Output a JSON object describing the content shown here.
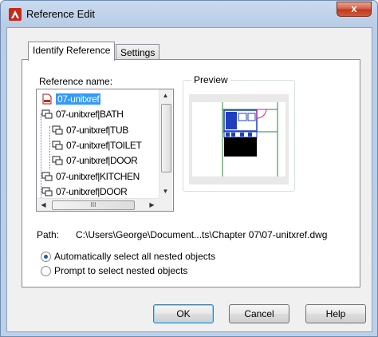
{
  "window": {
    "title": "Reference Edit",
    "close_glyph": "x",
    "app_icon": "autocad-logo-icon",
    "accent": "#c0391e"
  },
  "tabs": [
    {
      "label": "Identify Reference",
      "active": true
    },
    {
      "label": "Settings",
      "active": false
    }
  ],
  "reference": {
    "label": "Reference name:",
    "items": [
      {
        "text": "07-unitxref",
        "icon": "drawing-file-icon",
        "selected": true
      },
      {
        "text": "07-unitxref|BATH",
        "icon": "block-icon"
      },
      {
        "text": "07-unitxref|TUB",
        "icon": "block-icon"
      },
      {
        "text": "07-unitxref|TOILET",
        "icon": "block-icon"
      },
      {
        "text": "07-unitxref|DOOR",
        "icon": "block-icon"
      },
      {
        "text": "07-unitxref|KITCHEN",
        "icon": "block-icon"
      },
      {
        "text": "07-unitxref|DOOR",
        "icon": "block-icon"
      }
    ],
    "scroll_glyph": "III"
  },
  "preview": {
    "label": "Preview"
  },
  "path": {
    "label": "Path:",
    "value": "C:\\Users\\George\\Document...ts\\Chapter 07\\07-unitxref.dwg"
  },
  "options": [
    {
      "label": "Automatically select all nested objects",
      "checked": true
    },
    {
      "label": "Prompt to select nested objects",
      "checked": false
    }
  ],
  "buttons": {
    "ok": "OK",
    "cancel": "Cancel",
    "help": "Help"
  }
}
